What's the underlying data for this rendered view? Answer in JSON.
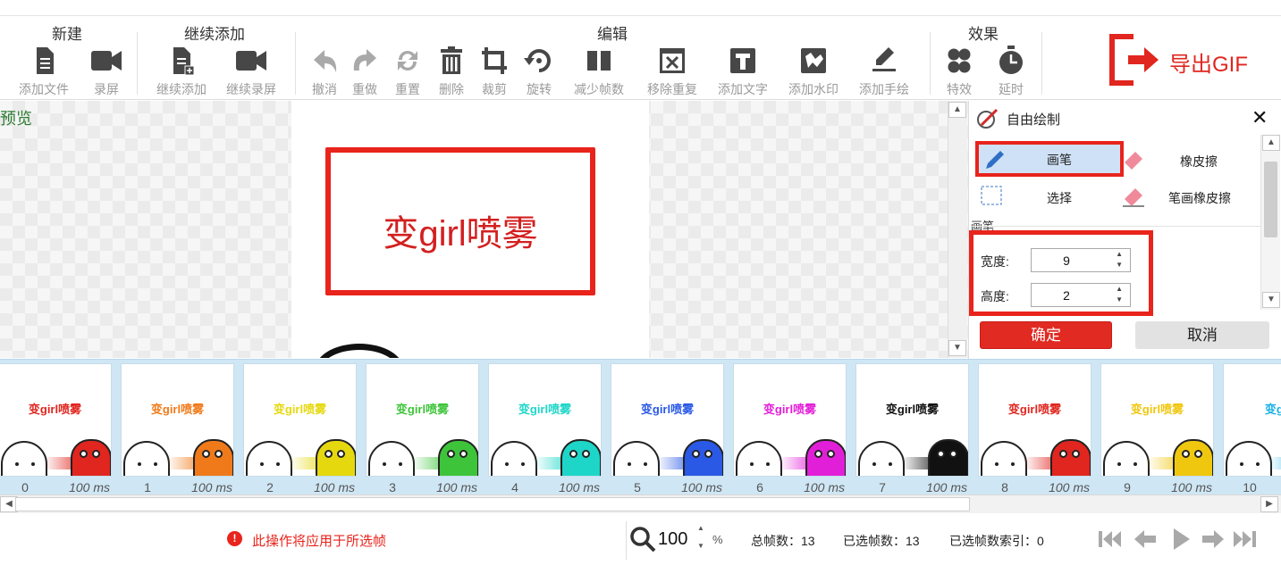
{
  "toolbar": {
    "groups": {
      "new": "新建",
      "continue": "继续添加",
      "edit": "编辑",
      "effects": "效果"
    },
    "tools": {
      "add_file": "添加文件",
      "record": "录屏",
      "continue_add": "继续添加",
      "continue_record": "继续录屏",
      "undo": "撤消",
      "redo": "重做",
      "reset": "重置",
      "delete": "删除",
      "crop": "裁剪",
      "rotate": "旋转",
      "reduce_frames": "减少帧数",
      "remove_dup": "移除重复",
      "add_text": "添加文字",
      "add_watermark": "添加水印",
      "add_drawing": "添加手绘",
      "special_effects": "特效",
      "delay": "延时"
    },
    "export_label": "导出GIF"
  },
  "preview": {
    "label": "预览",
    "canvas_text": "变girl喷雾"
  },
  "panel": {
    "title": "自由绘制",
    "close_icon": "close-icon",
    "tools": {
      "pen": "画笔",
      "eraser": "橡皮擦",
      "select": "选择",
      "stroke_eraser": "笔画橡皮擦"
    },
    "section_label": "画笔",
    "width_label": "宽度:",
    "width_value": "9",
    "height_label": "高度:",
    "height_value": "2",
    "confirm_label": "确定",
    "cancel_label": "取消"
  },
  "frames": [
    {
      "index": "0",
      "duration": "100 ms",
      "text": "变girl喷雾",
      "color": "#e0261f"
    },
    {
      "index": "1",
      "duration": "100 ms",
      "text": "变girl喷雾",
      "color": "#f07a1a"
    },
    {
      "index": "2",
      "duration": "100 ms",
      "text": "变girl喷雾",
      "color": "#e6d80f"
    },
    {
      "index": "3",
      "duration": "100 ms",
      "text": "变girl喷雾",
      "color": "#3ec43a"
    },
    {
      "index": "4",
      "duration": "100 ms",
      "text": "变girl喷雾",
      "color": "#1ed6c8"
    },
    {
      "index": "5",
      "duration": "100 ms",
      "text": "变girl喷雾",
      "color": "#2a59e6"
    },
    {
      "index": "6",
      "duration": "100 ms",
      "text": "变girl喷雾",
      "color": "#e21fd8"
    },
    {
      "index": "7",
      "duration": "100 ms",
      "text": "变girl喷雾",
      "color": "#111111"
    },
    {
      "index": "8",
      "duration": "100 ms",
      "text": "变girl喷雾",
      "color": "#e0261f"
    },
    {
      "index": "9",
      "duration": "100 ms",
      "text": "变girl喷雾",
      "color": "#f0c70f"
    },
    {
      "index": "10",
      "duration": "",
      "text": "变girl",
      "color": "#1ab1e6"
    }
  ],
  "status": {
    "warning": "此操作将应用于所选帧",
    "zoom_value": "100",
    "zoom_unit": "%",
    "total_frames": "总帧数：13",
    "selected_frames": "已选帧数：13",
    "selected_index": "已选帧数索引：0"
  },
  "colors": {
    "accent_red": "#e8241c",
    "selected_blue": "#cfe1f6",
    "strip_bg": "#cfe6f4"
  }
}
